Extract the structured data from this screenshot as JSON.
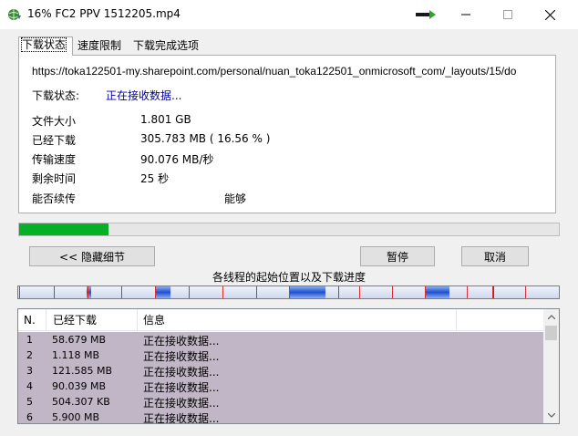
{
  "window": {
    "title": "16% FC2 PPV 1512205.mp4",
    "icon": "globe-download-icon"
  },
  "tabs": [
    {
      "label": "下载状态",
      "active": true
    },
    {
      "label": "速度限制",
      "active": false
    },
    {
      "label": "下载完成选项",
      "active": false
    }
  ],
  "status": {
    "url": "https://toka122501-my.sharepoint.com/personal/nuan_toka122501_onmicrosoft_com/_layouts/15/do",
    "status_label": "下载状态:",
    "status_value": "正在接收数据...",
    "file_size_label": "文件大小",
    "file_size_value": "1.801  GB",
    "downloaded_label": "已经下载",
    "downloaded_value": "305.783  MB  ( 16.56 % )",
    "speed_label": "传输速度",
    "speed_value": "90.076  MB/秒",
    "remaining_label": "剩余时间",
    "remaining_value": "25 秒",
    "resume_label": "能否续传",
    "resume_value": "能够"
  },
  "progress": {
    "percent": 16.56
  },
  "buttons": {
    "hide_details": "<< 隐藏细节",
    "pause": "暂停",
    "cancel": "取消"
  },
  "threads": {
    "title": "各线程的起始位置以及下载进度",
    "accent_color": "#1f4fd0"
  },
  "connections": {
    "headers": [
      "N.",
      "已经下载",
      "信息",
      ""
    ],
    "rows": [
      {
        "n": "1",
        "downloaded": "58.679  MB",
        "info": "正在接收数据..."
      },
      {
        "n": "2",
        "downloaded": "1.118  MB",
        "info": "正在接收数据..."
      },
      {
        "n": "3",
        "downloaded": "121.585  MB",
        "info": "正在接收数据..."
      },
      {
        "n": "4",
        "downloaded": "90.039  MB",
        "info": "正在接收数据..."
      },
      {
        "n": "5",
        "downloaded": "504.307  KB",
        "info": "正在接收数据..."
      },
      {
        "n": "6",
        "downloaded": "5.900  MB",
        "info": "正在接收数据..."
      }
    ]
  }
}
